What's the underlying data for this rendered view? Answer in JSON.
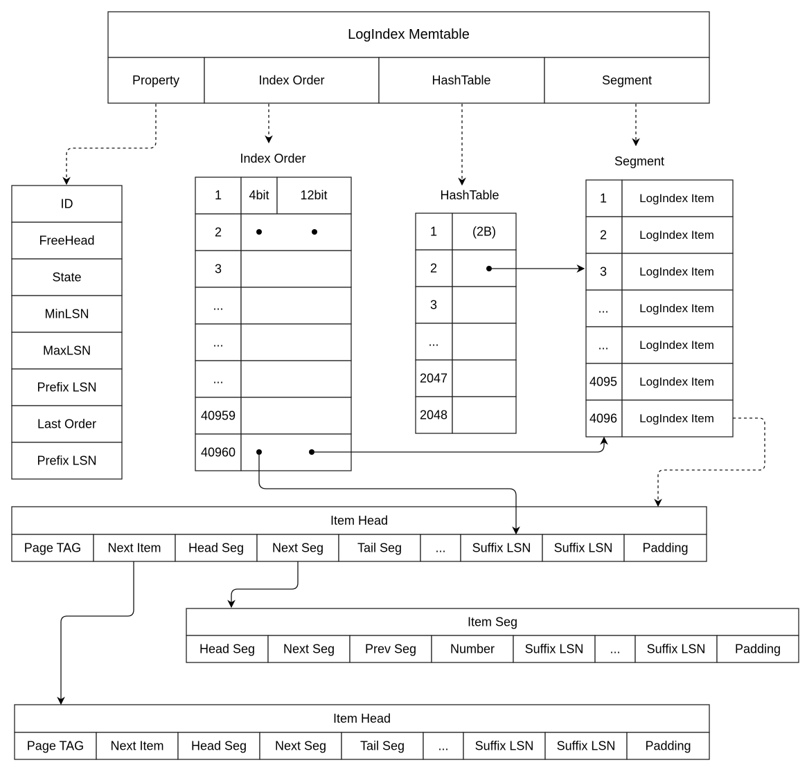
{
  "memtable": {
    "title": "LogIndex Memtable",
    "fields": [
      "Property",
      "Index Order",
      "HashTable",
      "Segment"
    ]
  },
  "property": {
    "rows": [
      "ID",
      "FreeHead",
      "State",
      "MinLSN",
      "MaxLSN",
      "Prefix LSN",
      "Last Order",
      "Prefix LSN"
    ]
  },
  "index_order": {
    "title": "Index Order",
    "header": [
      "1",
      "4bit",
      "12bit"
    ],
    "rows": [
      "2",
      "3",
      "...",
      "...",
      "...",
      "40959",
      "40960"
    ]
  },
  "hashtable": {
    "title": "HashTable",
    "rows": [
      {
        "key": "1",
        "value": "(2B)"
      },
      {
        "key": "2",
        "value": ""
      },
      {
        "key": "3",
        "value": ""
      },
      {
        "key": "...",
        "value": ""
      },
      {
        "key": "2047",
        "value": ""
      },
      {
        "key": "2048",
        "value": ""
      }
    ]
  },
  "segment": {
    "title": "Segment",
    "rows": [
      {
        "key": "1",
        "value": "LogIndex Item"
      },
      {
        "key": "2",
        "value": "LogIndex Item"
      },
      {
        "key": "3",
        "value": "LogIndex Item"
      },
      {
        "key": "...",
        "value": "LogIndex Item"
      },
      {
        "key": "...",
        "value": "LogIndex Item"
      },
      {
        "key": "4095",
        "value": "LogIndex Item"
      },
      {
        "key": "4096",
        "value": "LogIndex Item"
      }
    ]
  },
  "item_head_1": {
    "title": "Item Head",
    "fields": [
      "Page TAG",
      "Next Item",
      "Head Seg",
      "Next Seg",
      "Tail Seg",
      "...",
      "Suffix LSN",
      "Suffix LSN",
      "Padding"
    ]
  },
  "item_seg": {
    "title": "Item Seg",
    "fields": [
      "Head Seg",
      "Next Seg",
      "Prev Seg",
      "Number",
      "Suffix LSN",
      "...",
      "Suffix LSN",
      "Padding"
    ]
  },
  "item_head_2": {
    "title": "Item Head",
    "fields": [
      "Page TAG",
      "Next Item",
      "Head Seg",
      "Next Seg",
      "Tail Seg",
      "...",
      "Suffix LSN",
      "Suffix LSN",
      "Padding"
    ]
  }
}
